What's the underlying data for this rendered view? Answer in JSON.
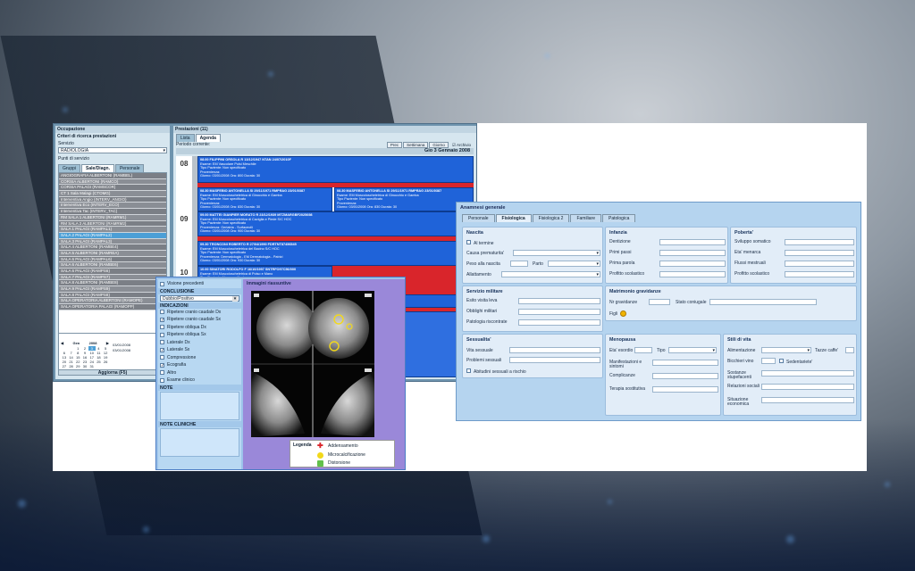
{
  "scheduler": {
    "title": "Occupazione",
    "criteria_title": "Criteri di ricerca prestazioni",
    "service_label": "Servizio",
    "service_value": "RADIOLOGIA",
    "points_label": "Punti di servizio",
    "tabs": [
      "Gruppi",
      "Sale/Diagn.",
      "Personale"
    ],
    "rooms": [
      "ANGIOGRAFIA ALBERTONI (RAMBEL)",
      "CORSIA ALBERTONI (RAMCO)",
      "CORSIA PALAGI (RAMSCOR)",
      "CT 1 Sala Malagi (CTOMG)",
      "Interventiva Angio (INTERV_ANGIO)",
      "Interventiva Eco (INTERV_ECO)",
      "Interventiva Tac (INTERV_TAC)",
      "RM SALA 1 ALBERTONI (RAMRM1)",
      "RM SALA 2 ALBERTONI (RAMRM2)",
      "SALA 1 PALAGI (RAMPAL1)",
      "SALA 2 PALAGI (RAMPAL2)",
      "SALA 3 PALAGI (RAMPAL3)",
      "SALA 4 ALBERTONI (RAMBE4)",
      "SALA 5 ALBERTONI (RAMREA)",
      "SALA 6 PALAGI (RAMPAL6)",
      "SALA 6 ALBERTONI (RAMBE6)",
      "SALA 6 PALAGI (RAMPS6)",
      "SALA 7 PALAGI (RAMPS7)",
      "SALA 8 ALBERTONI (RAMBE8)",
      "SALA 9 PALAGI (RAMPS9)",
      "SALA 8 PALAGI (RAMPS8)",
      "SALA OPERATORIA ALBERTONI (RAMOPE)",
      "SALA OPERATORIA PALAGI (RAMOPP)"
    ],
    "calendar": {
      "month": "Gen",
      "year": "2008",
      "days": [
        "1",
        "2",
        "3",
        "4",
        "5",
        "6",
        "7",
        "8",
        "9",
        "10",
        "11",
        "12",
        "13",
        "14",
        "15",
        "16",
        "17",
        "18",
        "19",
        "20",
        "21",
        "22",
        "23",
        "24",
        "25",
        "26",
        "27",
        "28",
        "29",
        "30",
        "31"
      ],
      "selected": "3",
      "side_dates": [
        "03/01/2008",
        "03/01/2008"
      ]
    },
    "update_button": "Aggiorna (F5)",
    "right_title": "Prestazioni (11)",
    "view_tabs": [
      "Lista",
      "Agenda"
    ],
    "period_label": "Periodo corrente:",
    "toolbar_buttons": [
      "Prec",
      "Settimana",
      "Giorno"
    ],
    "toolbar_extra": "Archivio",
    "date_header": "Gio 3 Gennaio 2008",
    "hours": [
      "08",
      "09",
      "10"
    ],
    "appointments": [
      {
        "t": "08.00 FILIPPINI ORSOLA R 13/12/1947 NTAN 24/07/2010F",
        "l": [
          "Esame: EM Vascolare Polsi Meschile",
          "Tipo Paziente: Non specificato",
          "Provenienza:",
          "Giorno: 03/01/2008  Ora: 800  Durata: 30"
        ]
      },
      {
        "t": "08.30 MASFEBIO ANTONELLA SI 29/11/1971 RMPRAG 23/01/0387",
        "l": [
          "Esame: EM Muscoloscheletrica di Ginocchio e Gamba",
          "Tipo Paziente: Non specificato",
          "Provenienza:",
          "Giorno: 03/01/2008  Ora: 830  Durata: 30"
        ]
      },
      {
        "t": "08.30 MASFEBIO ANTONELLA SI 29/11/1971 RMPRAG 23/01/0387",
        "l": [
          "Esame: EM Muscoloscheletrica di Ginocchio e Gamba",
          "Tipo Paziente: Non specificato",
          "Provenienza:",
          "Giorno: 03/01/2008  Ora: 830  Durata: 30"
        ]
      },
      {
        "t": "09.00 MATTEI GIANPIER MORATO R 23/12/1939 MTZMARGBF2025698",
        "l": [
          "Esame: EM Muscoloscheletrica di Caviglia e Piede S/C HOC",
          "Tipo Paziente: Non specificato",
          "Provenienza: Geriatria - Surfaceolli",
          "Giorno: 03/01/2008  Ora: 900  Durata: 30"
        ]
      },
      {
        "t": "09.30 TRONCONI ROBERTO R 27/04/1990 FDRTNT87456545",
        "l": [
          "Esame: EM Muscoloscheletrica del Bacino S/C HOC",
          "Tipo Paziente: Non specificato",
          "Provenienza: Dermatologia - EM Dermatologia - Patrizi",
          "Giorno: 03/01/2008  Ora: 930  Durata: 30"
        ]
      },
      {
        "t": "10.00 SINATORI RODOLFO F 16/10/1997 SNTRFO97C56/000",
        "l": [
          "Esame: EM Muscoloscheletrica di Polso e Mano",
          "Tipo Paziente: Non specificato",
          "Provenienza:",
          "Giorno: 03/01/2008  Ora: 1000  Durata: 30"
        ]
      }
    ]
  },
  "mammo": {
    "items_a": [
      {
        "label": "Visione precedenti",
        "checked": false
      }
    ],
    "conclusion_title": "CONCLUSIONE",
    "conclusion_value": "Dubbio/Positivo",
    "indications_title": "INDICAZIONI",
    "indications": [
      {
        "label": "Ripetere cranio caudale Dx",
        "checked": false
      },
      {
        "label": "Ripetere cranio caudale Sx",
        "checked": true
      },
      {
        "label": "Ripetere obliqua Dx",
        "checked": false
      },
      {
        "label": "Ripetere obliqua Sx",
        "checked": false
      },
      {
        "label": "Laterale Dx",
        "checked": false
      },
      {
        "label": "Laterale Sx",
        "checked": true
      },
      {
        "label": "Compressione",
        "checked": false
      },
      {
        "label": "Ecografia",
        "checked": true
      },
      {
        "label": "Altro",
        "checked": false
      },
      {
        "label": "Esame clinico",
        "checked": false
      }
    ],
    "note_title": "NOTE",
    "clinical_notes_title": "NOTE CLINICHE",
    "image_caption": "Immagini riassuntive",
    "legend_title": "Legenda",
    "legend": [
      {
        "label": "Addensamento",
        "color": "#d9252b"
      },
      {
        "label": "Microcalcificazione",
        "color": "#f2d81a"
      },
      {
        "label": "Distorsione",
        "color": "#62c04b"
      }
    ]
  },
  "anamnesis": {
    "title": "Anamnesi generale",
    "tabs": [
      "Personale",
      "Fisiologica",
      "Fisiologica 2",
      "Familiare",
      "Patologica"
    ],
    "active_tab": 1,
    "nascita": {
      "title": "Nascita",
      "at_term": "Al termine",
      "premature_cause": "Causa prematurita'",
      "birth_weight": "Peso alla nascita",
      "delivery": "Parto",
      "breastfeeding": "Allattamento"
    },
    "infanzia": {
      "title": "Infanzia",
      "fields": [
        "Dentizione",
        "Primi passi",
        "Prima parola",
        "Profitto scolastico"
      ]
    },
    "puberta": {
      "title": "Poberta'",
      "fields": [
        "Sviluppo somatico",
        "Eta' menarca",
        "Flussi mestruali",
        "Profitto scolastico"
      ]
    },
    "militare": {
      "title": "Servizio militare",
      "fields": [
        "Esito visita leva",
        "Obblighi militari",
        "Patologia riscontrate"
      ]
    },
    "matrimonio": {
      "title": "Matrimonio gravidanze",
      "pregnancies": "Nr gravidanze",
      "marital": "Stato coniugale",
      "children": "Figli"
    },
    "sessualita": {
      "title": "Sessualita'",
      "sexual_life": "Vita sessuale",
      "sexual_problems": "Problemi sessuali",
      "risk": "Abitudini sessuali a rischio"
    },
    "menopausa": {
      "title": "Menopausa",
      "onset": "Eta' esordio",
      "type": "Tipo",
      "fields": [
        "Manifestazioni e sintomi",
        "Complicanze",
        "Terapia sostitutiva"
      ]
    },
    "stili": {
      "title": "Stili di vita",
      "diet": "Alimentazione",
      "coffee": "Tazze caffe'",
      "wine": "Bicchieri vino",
      "sedentary": "Sedentariete'",
      "fields": [
        "Sostanze stupefacenti",
        "Relazioni sociali",
        "Situazione economica"
      ]
    }
  }
}
